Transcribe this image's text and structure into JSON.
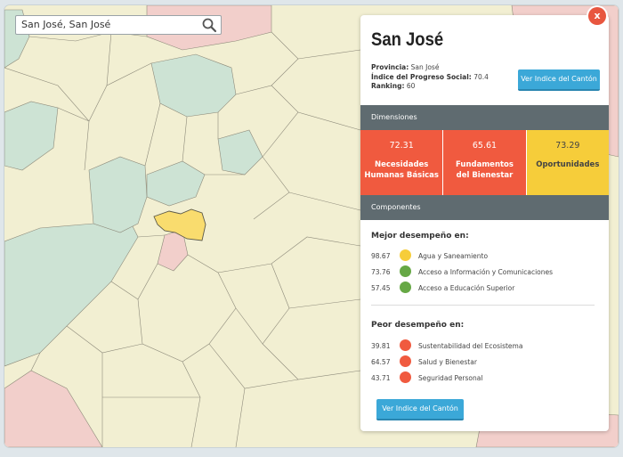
{
  "search": {
    "value": "San José, San José",
    "icon": "search-icon"
  },
  "panel": {
    "title": "San José",
    "close_label": "x",
    "provincia_label": "Provincia:",
    "provincia_value": "San José",
    "ips_label": "Índice del Progreso Social:",
    "ips_value": "70.4",
    "ranking_label": "Ranking:",
    "ranking_value": "60",
    "top_button": "Ver Indice del Cantón",
    "bottom_button": "Ver Indice del Cantón",
    "dimensions_header": "Dimensiones",
    "components_header": "Componentes",
    "dimensions": [
      {
        "value": "72.31",
        "label_line1": "Necesidades",
        "label_line2": "Humanas Básicas",
        "color": "#f05a3f"
      },
      {
        "value": "65.61",
        "label_line1": "Fundamentos",
        "label_line2": "del Bienestar",
        "color": "#f05a3f"
      },
      {
        "value": "73.29",
        "label_line1": "Oportunidades",
        "label_line2": "",
        "color": "#f6cd3a"
      }
    ],
    "best": {
      "title": "Mejor desempeño en:",
      "items": [
        {
          "score": "98.67",
          "name": "Agua y Saneamiento",
          "color": "#f6cd3a"
        },
        {
          "score": "73.76",
          "name": "Acceso a Información y Comunicaciones",
          "color": "#66a845"
        },
        {
          "score": "57.45",
          "name": "Acceso a Educación Superior",
          "color": "#66a845"
        }
      ]
    },
    "worst": {
      "title": "Peor desempeño en:",
      "items": [
        {
          "score": "39.81",
          "name": "Sustentabilidad del Ecosistema",
          "color": "#f05a3f"
        },
        {
          "score": "64.57",
          "name": "Salud y Bienestar",
          "color": "#f05a3f"
        },
        {
          "score": "43.71",
          "name": "Seguridad Personal",
          "color": "#f05a3f"
        }
      ]
    }
  },
  "map_colors": {
    "base": "#f2efd2",
    "green": "#cde3d4",
    "pink": "#f2cfcb",
    "selected": "#f9dc6e"
  }
}
